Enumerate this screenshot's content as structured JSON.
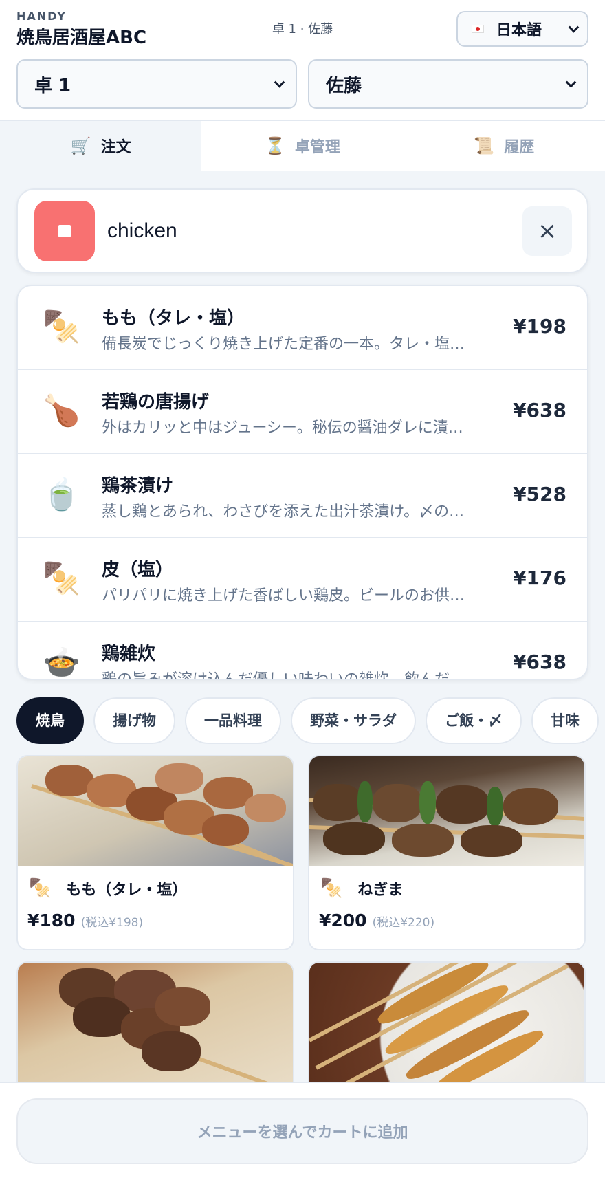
{
  "header": {
    "brand_small": "HANDY",
    "brand_name": "焼鳥居酒屋ABC",
    "context": "卓 1 · 佐藤",
    "language": "日本語",
    "table_select": "卓 1",
    "staff_select": "佐藤"
  },
  "tabs": [
    {
      "label": "注文",
      "icon": "cart-icon",
      "active": true
    },
    {
      "label": "卓管理",
      "icon": "hourglass-icon",
      "active": false
    },
    {
      "label": "履歴",
      "icon": "scroll-icon",
      "active": false
    }
  ],
  "search": {
    "value": "chicken",
    "clear_label": "×"
  },
  "results": [
    {
      "icon": "oden-skewer-icon",
      "glyph": "🍢",
      "name": "もも（タレ・塩）",
      "desc": "備長炭でじっくり焼き上げた定番の一本。タレ・塩…",
      "price": "¥198"
    },
    {
      "icon": "poultry-leg-icon",
      "glyph": "🍗",
      "name": "若鶏の唐揚げ",
      "desc": "外はカリッと中はジューシー。秘伝の醤油ダレに漬…",
      "price": "¥638"
    },
    {
      "icon": "tea-icon",
      "glyph": "🍵",
      "name": "鶏茶漬け",
      "desc": "蒸し鶏とあられ、わさびを添えた出汁茶漬け。〆の…",
      "price": "¥528"
    },
    {
      "icon": "oden-skewer-icon",
      "glyph": "🍢",
      "name": "皮（塩）",
      "desc": "パリパリに焼き上げた香ばしい鶏皮。ビールのお供…",
      "price": "¥176"
    },
    {
      "icon": "soup-bowl-icon",
      "glyph": "🍲",
      "name": "鶏雑炊",
      "desc": "鶏の旨みが溶け込んだ優しい味わいの雑炊。飲んだ…",
      "price": "¥638"
    }
  ],
  "categories": [
    {
      "label": "焼鳥",
      "active": true
    },
    {
      "label": "揚げ物",
      "active": false
    },
    {
      "label": "一品料理",
      "active": false
    },
    {
      "label": "野菜・サラダ",
      "active": false
    },
    {
      "label": "ご飯・〆",
      "active": false
    },
    {
      "label": "甘味",
      "active": false
    }
  ],
  "menu_cards": [
    {
      "icon": "oden-skewer-icon",
      "glyph": "🍢",
      "name": "もも（タレ・塩）",
      "price": "¥180",
      "tax": "(税込¥198)"
    },
    {
      "icon": "oden-skewer-icon",
      "glyph": "🍢",
      "name": "ねぎま",
      "price": "¥200",
      "tax": "(税込¥220)"
    },
    {
      "icon": "",
      "glyph": "",
      "name": "",
      "price": "",
      "tax": ""
    },
    {
      "icon": "",
      "glyph": "",
      "name": "",
      "price": "",
      "tax": ""
    }
  ],
  "footer": {
    "cart_button": "メニューを選んでカートに追加"
  },
  "colors": {
    "accent_dark": "#0f172a",
    "stop_button": "#f87171",
    "muted": "#94a3b8"
  }
}
